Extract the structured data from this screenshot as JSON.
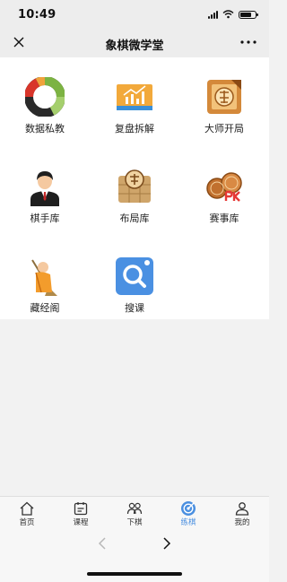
{
  "status_bar": {
    "time": "10:49"
  },
  "nav": {
    "title": "象棋微学堂"
  },
  "grid": {
    "items": [
      {
        "label": "数据私教",
        "icon": "data-tutor-icon"
      },
      {
        "label": "复盘拆解",
        "icon": "review-chart-icon"
      },
      {
        "label": "大师开局",
        "icon": "master-opening-icon"
      },
      {
        "label": "棋手库",
        "icon": "player-icon"
      },
      {
        "label": "布局库",
        "icon": "opening-board-icon"
      },
      {
        "label": "赛事库",
        "icon": "match-pk-icon"
      },
      {
        "label": "藏经阁",
        "icon": "monk-icon"
      },
      {
        "label": "搜课",
        "icon": "search-course-icon"
      }
    ]
  },
  "tabbar": {
    "tabs": [
      {
        "label": "首页",
        "icon": "home-icon",
        "active": false
      },
      {
        "label": "课程",
        "icon": "calendar-icon",
        "active": false
      },
      {
        "label": "下棋",
        "icon": "users-icon",
        "active": false
      },
      {
        "label": "练棋",
        "icon": "target-icon",
        "active": true
      },
      {
        "label": "我的",
        "icon": "profile-icon",
        "active": false
      }
    ],
    "active_color": "#4a8fe0"
  },
  "colors": {
    "search_icon_bg": "#4a90e2",
    "chess_icon_bg": "#e6b463"
  }
}
